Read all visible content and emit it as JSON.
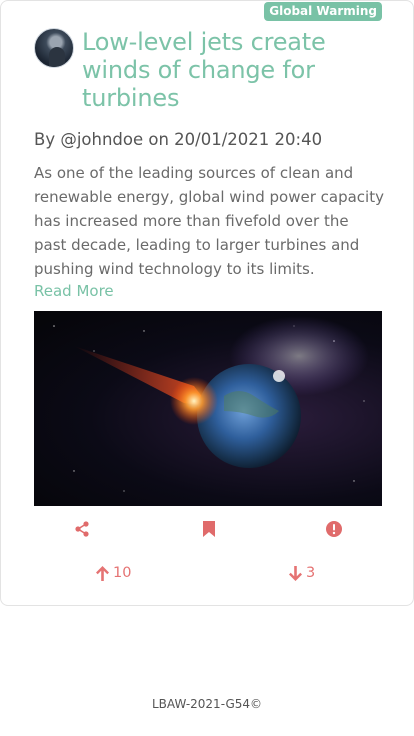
{
  "post": {
    "tag": "Global Warming",
    "title": "Low-level jets create winds of change for turbines",
    "byline": "By @johndoe on 20/01/2021 20:40",
    "excerpt": "As one of the leading sources of clean and renewable energy, global wind power capacity has increased more than fivefold over the past decade, leading to larger turbines and pushing wind technology to its limits.",
    "read_more": "Read More",
    "upvotes": "10",
    "downvotes": "3"
  },
  "icons": {
    "share": "share-icon",
    "bookmark": "bookmark-icon",
    "report": "exclamation-icon",
    "upvote": "arrow-up-icon",
    "downvote": "arrow-down-icon"
  },
  "colors": {
    "accent": "#79c2a6",
    "action": "#e57373"
  },
  "footer": {
    "text": "LBAW-2021-G54©"
  }
}
